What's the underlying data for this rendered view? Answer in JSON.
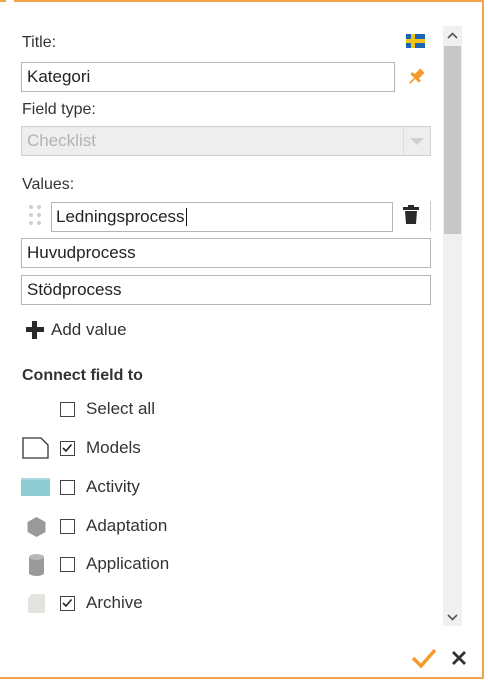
{
  "form": {
    "title_label": "Title:",
    "title_value": "Kategori",
    "field_type_label": "Field type:",
    "field_type_value": "Checklist",
    "values_label": "Values:",
    "values": [
      "Ledningsprocess",
      "Huvudprocess",
      "Stödprocess"
    ],
    "add_value_label": "Add value"
  },
  "connect": {
    "title": "Connect field to",
    "select_all": {
      "label": "Select all",
      "checked": false
    },
    "items": [
      {
        "label": "Models",
        "checked": true,
        "icon": "document-shape-icon"
      },
      {
        "label": "Activity",
        "checked": false,
        "icon": "activity-rect-icon"
      },
      {
        "label": "Adaptation",
        "checked": false,
        "icon": "hexagon-icon"
      },
      {
        "label": "Application",
        "checked": false,
        "icon": "cylinder-icon"
      },
      {
        "label": "Archive",
        "checked": true,
        "icon": "archive-shape-icon"
      }
    ]
  },
  "colors": {
    "accent": "#f0a34a",
    "confirm": "#f39a2a",
    "activity_fill": "#8fcdd3"
  },
  "language_flag": "sweden-flag-icon"
}
